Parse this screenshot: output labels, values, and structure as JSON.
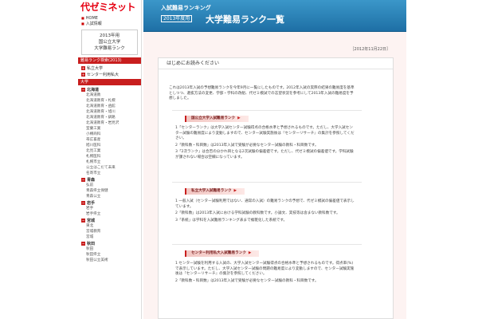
{
  "sidebar": {
    "logo": "代ゼミネット",
    "links": [
      "HOME",
      "入試情報"
    ],
    "year_box": [
      "2013年用",
      "国公立大学",
      "大学難易ランク"
    ],
    "ranking_header": "難易ランク検索(2013)",
    "categories": [
      "私立大学",
      "センター利用私大"
    ],
    "pref_header": "大学",
    "hokkaido_label": "北海道",
    "hokkaido_items": [
      "北海道教",
      "北海道教育・札幌",
      "北海道教育・函館",
      "北海道教育・旭川",
      "北海道教育・釧路",
      "北海道教育・岩見沢",
      "室蘭工業",
      "小樽商科",
      "帯広畜産",
      "旭川医科",
      "北見工業",
      "札幌医科",
      "札幌市立",
      "公立はこだて未来",
      "名寄市立"
    ],
    "aomori_label": "青森",
    "aomori_items": [
      "弘前",
      "青森県立保健",
      "青森公立"
    ],
    "iwate_label": "岩手",
    "iwate_items": [
      "岩手",
      "岩手県立"
    ],
    "miyagi_label": "宮城",
    "miyagi_items": [
      "東北",
      "宮城教育",
      "宮城"
    ],
    "akita_label": "秋田",
    "akita_items": [
      "秋田",
      "秋田県立",
      "秋田公立美術"
    ]
  },
  "header": {
    "subtitle": "入試難易ランキング",
    "year": "2013年度用",
    "title": "大学難易ランク一覧"
  },
  "main": {
    "date": "［2012年11月22日］",
    "panel_title": "はじめにお読みください",
    "intro": "これは2013年入試の予想難易ランクを今年9月に一覧にしたものです。2012年入試の実際の結果の難易度を基準としつつ、選抜方法の変更、学部・学科の改組、代ゼミ模試での志望状況を参考にして2013年入試の難易度を予想しました。",
    "section1": {
      "label": "国公立大学入試難易ランク",
      "items": [
        "1「センターランク」は大学入試センター試験得点の合格水準と予想されるものです。ただし、大学入試センター試験の難易度により変動しますので、センター試験実施後は『センターリサーチ』の集計を参照してください。",
        "2「教科数・科目数」は2013年入試で受験が必要なセンター試験の教科・科目数です。",
        "3「2次ランク」は合否の分かれ目となる2次試験の偏差値です。ただし、代ゼミ模試の偏差値です。学科試験が課されない場合は空欄になっています。"
      ]
    },
    "section2": {
      "label": "私立大学入試難易ランク",
      "items": [
        "1 一般入試（センター試験利用ではない、通常の入試）の難易ランクの予想で、代ゼミ模試の偏差値で表示しています。",
        "2「教科数」は2013年入試における学科試験の教科数です。小論文、実技等は含まない教科数です。",
        "3「系統」は学科を入試難易ランキング表まで複雑化した系統です。"
      ]
    },
    "section3": {
      "label": "センター利用私大入試難易ランク",
      "items": [
        "1 センター試験を利用する入試の、大学入試センター試験得点の合格水準と予想されるものです。得点率(%)で表示しています。ただし、大学入試センター試験の問題の難易度により変動しますので、センター試験実施後は『センターリサーチ』の集計を参照してください。",
        "2「教科数・科目数」は2013年入試で受験が必要なセンター試験の教科・科目数です。"
      ]
    }
  }
}
